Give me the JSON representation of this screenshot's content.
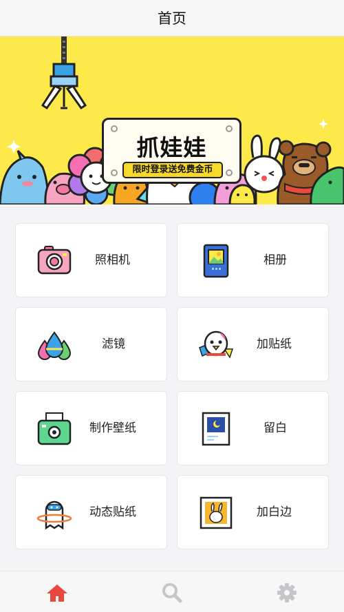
{
  "header": {
    "title": "首页"
  },
  "banner": {
    "title": "抓娃娃",
    "subtitle": "限时登录送免费金币",
    "background_color": "#fde94a"
  },
  "features": [
    {
      "label": "照相机",
      "icon": "camera-icon"
    },
    {
      "label": "相册",
      "icon": "album-icon"
    },
    {
      "label": "滤镜",
      "icon": "filter-drops-icon"
    },
    {
      "label": "加贴纸",
      "icon": "sticker-penguin-icon"
    },
    {
      "label": "制作壁纸",
      "icon": "wallpaper-printer-icon"
    },
    {
      "label": "留白",
      "icon": "whitespace-photo-icon"
    },
    {
      "label": "动态贴纸",
      "icon": "dynamic-sticker-icon"
    },
    {
      "label": "加白边",
      "icon": "white-border-icon"
    }
  ],
  "tabbar": {
    "items": [
      {
        "name": "home",
        "icon": "home-icon",
        "active": true
      },
      {
        "name": "search",
        "icon": "search-icon",
        "active": false
      },
      {
        "name": "settings",
        "icon": "gear-icon",
        "active": false
      }
    ],
    "active_color": "#e8483e",
    "inactive_color": "#c6c6ca"
  }
}
